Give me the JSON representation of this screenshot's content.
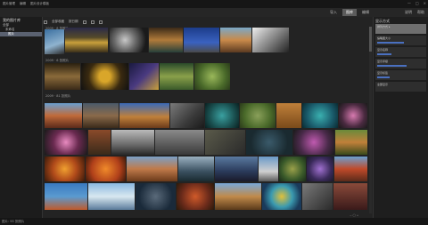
{
  "titlebar": {
    "menu": [
      "图片管理",
      "编辑",
      "图片设计模板"
    ],
    "controls": [
      "—",
      "□",
      "×"
    ]
  },
  "topbar": {
    "tabs": [
      {
        "label": "导入",
        "active": false
      },
      {
        "label": "图库",
        "active": true
      },
      {
        "label": "编辑",
        "active": false
      }
    ],
    "right_items": [
      "说明",
      "帮助"
    ]
  },
  "left_panel": {
    "header": "我的图片库",
    "items": [
      {
        "label": "全部",
        "level": 0,
        "selected": false
      },
      {
        "label": "未命名",
        "level": 1,
        "selected": false
      },
      {
        "label": "照片",
        "level": 2,
        "selected": true
      }
    ]
  },
  "toolbar": {
    "items": [
      "全部收藏",
      "按日期"
    ]
  },
  "groups": [
    {
      "label": "2009 · 8 张照片"
    },
    {
      "label": "2009 · 6 张照片"
    },
    {
      "label": "2009 · 81 张照片"
    }
  ],
  "right_panel": {
    "title": "显示方式",
    "items": [
      {
        "label": "排列方式 ▸",
        "fill": 0.0,
        "selected": true
      },
      {
        "label": "缩略图大小",
        "fill": 0.55,
        "selected": false
      },
      {
        "label": "显示名称",
        "fill": 0.3,
        "selected": false
      },
      {
        "label": "显示评级",
        "fill": 0.6,
        "selected": false
      },
      {
        "label": "显示标签",
        "fill": 0.25,
        "selected": false
      },
      {
        "label": "全部显示",
        "fill": 0.0,
        "selected": false
      }
    ]
  },
  "status": "图片: 95 张照片",
  "zoom": "− ◯ +",
  "colors": {
    "accent": "#4a70c0",
    "selected": "#5a6170",
    "background": "#232323"
  }
}
